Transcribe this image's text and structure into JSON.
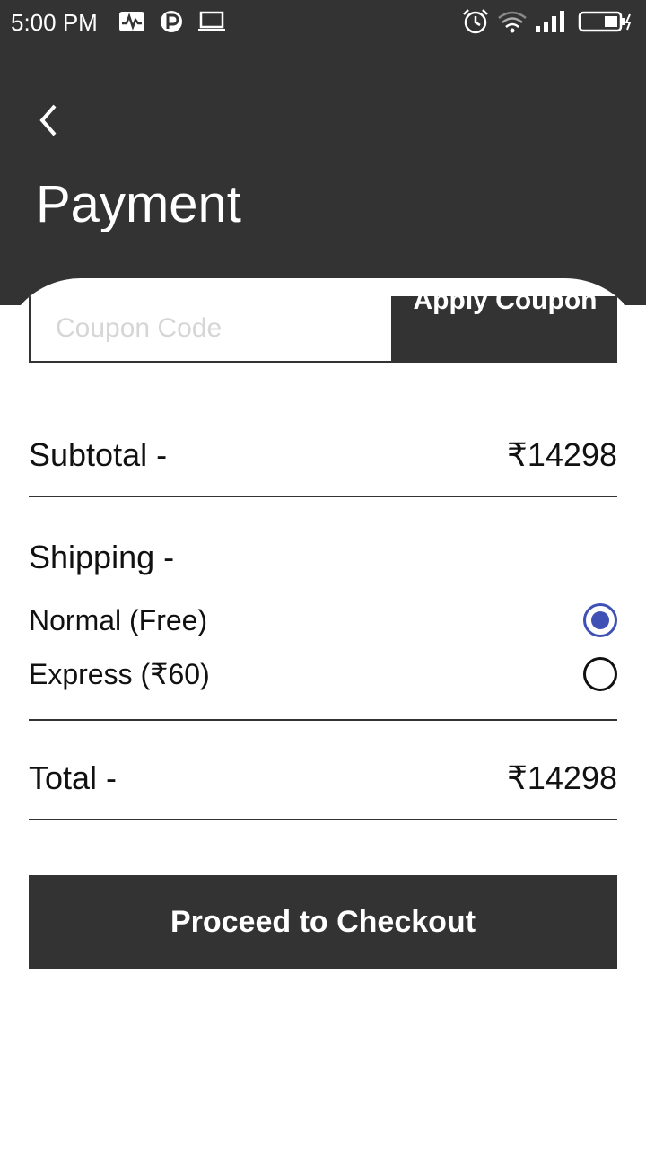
{
  "status_bar": {
    "time": "5:00 PM",
    "left_icons": [
      "activity-icon",
      "p-app-icon",
      "laptop-icon"
    ],
    "right_icons": [
      "alarm-icon",
      "wifi-icon",
      "signal-icon",
      "battery-icon"
    ]
  },
  "header": {
    "title": "Payment"
  },
  "coupon": {
    "placeholder": "Coupon Code",
    "button_label": "Apply Coupon"
  },
  "summary": {
    "subtotal_label": "Subtotal -",
    "subtotal_value": "₹14298",
    "shipping_label": "Shipping -",
    "shipping_options": [
      {
        "label": "Normal (Free)",
        "selected": true
      },
      {
        "label": "Express (₹60)",
        "selected": false
      }
    ],
    "total_label": "Total -",
    "total_value": "₹14298"
  },
  "checkout": {
    "button_label": "Proceed to Checkout"
  },
  "colors": {
    "dark": "#333333",
    "accent": "#3f51b5"
  }
}
